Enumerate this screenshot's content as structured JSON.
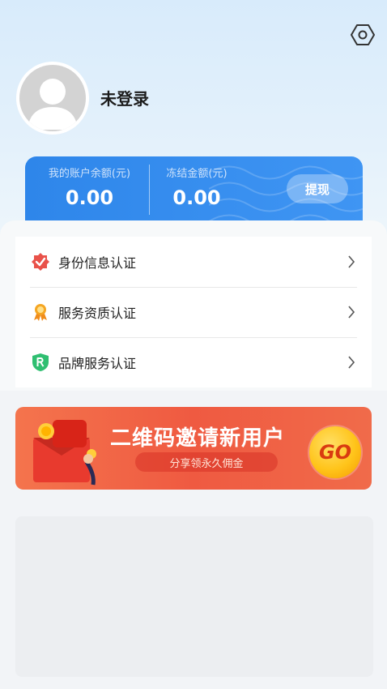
{
  "header": {
    "settings_icon": "settings-hexagon-icon"
  },
  "profile": {
    "username": "未登录",
    "avatar_icon": "default-avatar-icon"
  },
  "balance": {
    "account_label": "我的账户余额(元)",
    "account_value": "0.00",
    "frozen_label": "冻结金额(元)",
    "frozen_value": "0.00",
    "withdraw_label": "提现"
  },
  "certifications": [
    {
      "label": "身份信息认证",
      "icon": "verified-shield-icon",
      "color": "#e9524a"
    },
    {
      "label": "服务资质认证",
      "icon": "award-medal-icon",
      "color": "#f5a623"
    },
    {
      "label": "品牌服务认证",
      "icon": "brand-r-shield-icon",
      "color": "#2fbf71"
    }
  ],
  "banner": {
    "title": "二维码邀请新用户",
    "subtitle": "分享领永久佣金",
    "go_label": "GO"
  },
  "colors": {
    "primary_blue": "#2e86ea",
    "banner_red": "#ef5a41",
    "gold": "#ffc41a"
  }
}
